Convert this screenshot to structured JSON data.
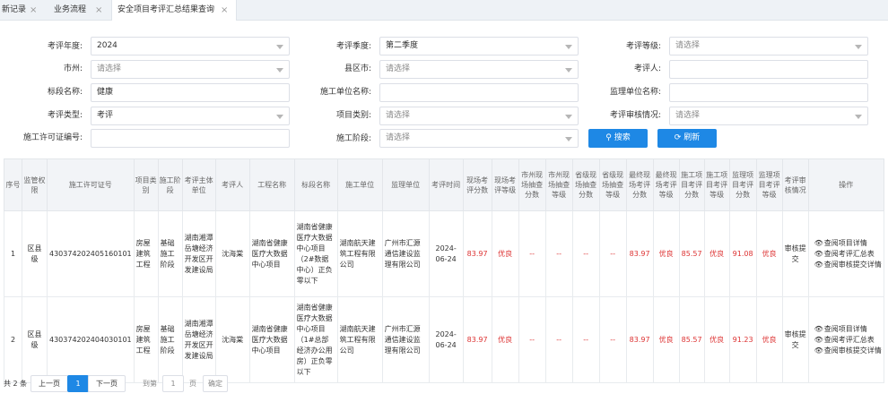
{
  "tabs": [
    {
      "label": "新记录",
      "active": false
    },
    {
      "label": "业务流程",
      "active": false
    },
    {
      "label": "安全项目考评汇总结果查询",
      "active": true
    }
  ],
  "filters": {
    "year": {
      "label": "考评年度:",
      "value": "2024"
    },
    "season": {
      "label": "考评季度:",
      "value": "第二季度"
    },
    "grade": {
      "label": "考评等级:",
      "placeholder": "请选择"
    },
    "city": {
      "label": "市州:",
      "placeholder": "请选择"
    },
    "county": {
      "label": "县区市:",
      "placeholder": "请选择"
    },
    "assessor": {
      "label": "考评人:",
      "value": ""
    },
    "section": {
      "label": "标段名称:",
      "value": "健康"
    },
    "construction_unit": {
      "label": "施工单位名称:",
      "value": ""
    },
    "supervision_unit": {
      "label": "监理单位名称:",
      "value": ""
    },
    "assess_type": {
      "label": "考评类型:",
      "value": "考评"
    },
    "project_type": {
      "label": "项目类别:",
      "placeholder": "请选择"
    },
    "audit_status": {
      "label": "考评审核情况:",
      "placeholder": "请选择"
    },
    "permit_no": {
      "label": "施工许可证编号:",
      "value": ""
    },
    "stage": {
      "label": "施工阶段:",
      "placeholder": "请选择"
    }
  },
  "buttons": {
    "search": "搜索",
    "refresh": "刷新"
  },
  "table": {
    "headers": [
      "序号",
      "监管权限",
      "施工许可证号",
      "项目类别",
      "施工阶段",
      "考评主体单位",
      "考评人",
      "工程名称",
      "标段名称",
      "施工单位",
      "监理单位",
      "考评时间",
      "现场考评分数",
      "现场考评等级",
      "市州现场抽查分数",
      "市州现场抽查等级",
      "省级现场抽查分数",
      "省级现场抽查等级",
      "最终现场考评分数",
      "最终现场考评等级",
      "施工项目考评分数",
      "施工项目考评等级",
      "监理项目考评分数",
      "监理项目考评等级",
      "考评审核情况",
      "操作"
    ],
    "rows": [
      {
        "no": "1",
        "authority": "区县级",
        "permit": "430374202405160101",
        "category": "房屋建筑工程",
        "stage": "基础施工阶段",
        "subject": "湖南湘潭岳塘经济开发区开发建设局",
        "assessor": "沈海棠",
        "project": "湖南省健康医疗大数据中心项目",
        "section": "湖南省健康医疗大数据中心项目（2#数据中心）正负零以下",
        "builder": "湖南航天建筑工程有限公司",
        "supervisor": "广州市汇源通信建设监理有限公司",
        "date": "2024-06-24",
        "site_score": "83.97",
        "site_grade": "优良",
        "city_score": "--",
        "city_grade": "--",
        "prov_score": "--",
        "prov_grade": "--",
        "final_score": "83.97",
        "final_grade": "优良",
        "build_score": "85.57",
        "build_grade": "优良",
        "sup_score": "91.08",
        "sup_grade": "优良",
        "audit": "审核提交"
      },
      {
        "no": "2",
        "authority": "区县级",
        "permit": "430374202404030101",
        "category": "房屋建筑工程",
        "stage": "基础施工阶段",
        "subject": "湖南湘潭岳塘经济开发区开发建设局",
        "assessor": "沈海棠",
        "project": "湖南省健康医疗大数据中心项目",
        "section": "湖南省健康医疗大数据中心项目（1#总部经济办公用房）正负零以下",
        "builder": "湖南航天建筑工程有限公司",
        "supervisor": "广州市汇源通信建设监理有限公司",
        "date": "2024-06-24",
        "site_score": "83.97",
        "site_grade": "优良",
        "city_score": "--",
        "city_grade": "--",
        "prov_score": "--",
        "prov_grade": "--",
        "final_score": "83.97",
        "final_grade": "优良",
        "build_score": "85.57",
        "build_grade": "优良",
        "sup_score": "91.23",
        "sup_grade": "优良",
        "audit": "审核提交"
      }
    ],
    "ops": [
      "查阅项目详情",
      "查阅考评汇总表",
      "查阅审核提交详情"
    ]
  },
  "pager": {
    "total": "共 2 条",
    "prev": "上一页",
    "current": "1",
    "next": "下一页",
    "goto": "到第",
    "page_value": "1",
    "page_unit": "页",
    "confirm": "确定"
  },
  "colors": {
    "accent": "#1e88e5",
    "score": "#dd3333"
  }
}
